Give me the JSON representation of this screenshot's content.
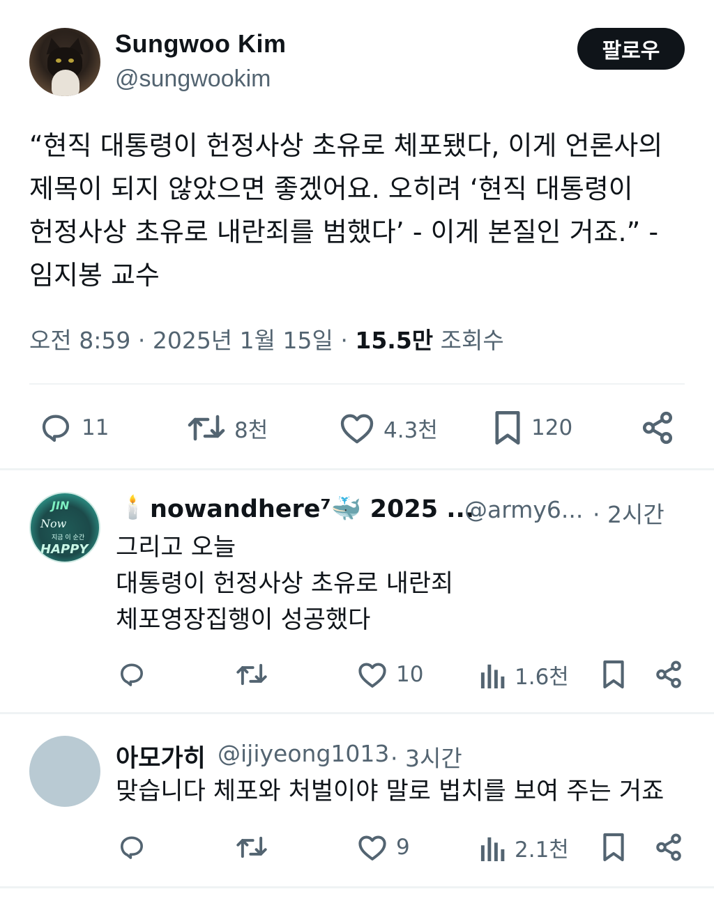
{
  "tweet": {
    "author_name": "Sungwoo Kim",
    "author_handle": "@sungwookim",
    "follow_label": "팔로우",
    "text": "“현직 대통령이 헌정사상 초유로 체포됐다, 이게 언론사의 제목이 되지 않았으면 좋겠어요. 오히려 ‘현직 대통령이 헌정사상 초유로 내란죄를 범했다’ - 이게 본질인 거죠.” - 임지봉 교수",
    "time": "오전 8:59",
    "separator": "·",
    "date": "2025년 1월 15일",
    "views_count": "15.5만",
    "views_label": "조회수",
    "actions": {
      "replies": "11",
      "retweets": "8천",
      "likes": "4.3천",
      "bookmarks": "120"
    }
  },
  "replies": [
    {
      "name_prefix_emoji": "🕯️",
      "name": "nowandhere⁷🐳 2025 ...",
      "handle": "@army6...",
      "time": "· 2시간",
      "avatar_text": {
        "top": "JIN",
        "now": "Now",
        "small": "지금 이 순간",
        "bottom": "HAPPY"
      },
      "lines": [
        "그리고 오늘",
        "대통령이 헌정사상 초유로 내란죄",
        "체포영장집행이 성공했다"
      ],
      "actions": {
        "replies": "",
        "retweets": "",
        "likes": "10",
        "views": "1.6천"
      }
    },
    {
      "name": "아모가히",
      "handle": "@ijiyeong1013",
      "time": "· 3시간",
      "lines": [
        "맞습니다 체포와 처벌이야 말로 법치를 보여 주는 거죠"
      ],
      "actions": {
        "replies": "",
        "retweets": "",
        "likes": "9",
        "views": "2.1천"
      }
    }
  ],
  "icons": {
    "reply": "speech-bubble-icon",
    "retweet": "retweet-arrows-icon",
    "like": "heart-icon",
    "bookmark": "bookmark-icon",
    "share": "share-icon",
    "views": "bar-chart-icon"
  },
  "colors": {
    "text": "#0f1419",
    "secondary": "#536471",
    "divider": "#eff3f4",
    "button": "#0f1419"
  }
}
